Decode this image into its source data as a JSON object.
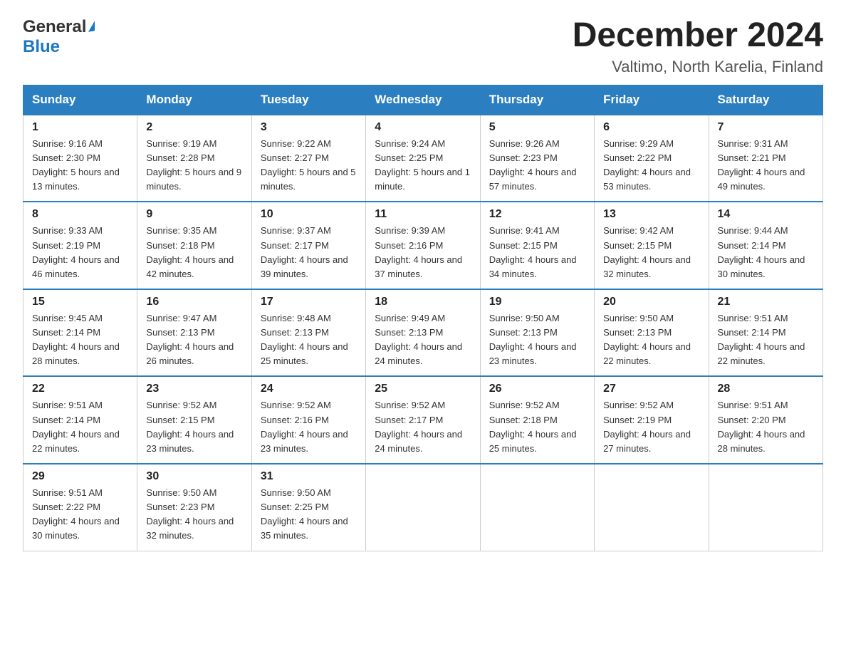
{
  "logo": {
    "general": "General",
    "triangle": "▶",
    "blue": "Blue"
  },
  "title": "December 2024",
  "subtitle": "Valtimo, North Karelia, Finland",
  "days": [
    "Sunday",
    "Monday",
    "Tuesday",
    "Wednesday",
    "Thursday",
    "Friday",
    "Saturday"
  ],
  "weeks": [
    [
      {
        "num": "1",
        "sunrise": "9:16 AM",
        "sunset": "2:30 PM",
        "daylight": "5 hours and 13 minutes."
      },
      {
        "num": "2",
        "sunrise": "9:19 AM",
        "sunset": "2:28 PM",
        "daylight": "5 hours and 9 minutes."
      },
      {
        "num": "3",
        "sunrise": "9:22 AM",
        "sunset": "2:27 PM",
        "daylight": "5 hours and 5 minutes."
      },
      {
        "num": "4",
        "sunrise": "9:24 AM",
        "sunset": "2:25 PM",
        "daylight": "5 hours and 1 minute."
      },
      {
        "num": "5",
        "sunrise": "9:26 AM",
        "sunset": "2:23 PM",
        "daylight": "4 hours and 57 minutes."
      },
      {
        "num": "6",
        "sunrise": "9:29 AM",
        "sunset": "2:22 PM",
        "daylight": "4 hours and 53 minutes."
      },
      {
        "num": "7",
        "sunrise": "9:31 AM",
        "sunset": "2:21 PM",
        "daylight": "4 hours and 49 minutes."
      }
    ],
    [
      {
        "num": "8",
        "sunrise": "9:33 AM",
        "sunset": "2:19 PM",
        "daylight": "4 hours and 46 minutes."
      },
      {
        "num": "9",
        "sunrise": "9:35 AM",
        "sunset": "2:18 PM",
        "daylight": "4 hours and 42 minutes."
      },
      {
        "num": "10",
        "sunrise": "9:37 AM",
        "sunset": "2:17 PM",
        "daylight": "4 hours and 39 minutes."
      },
      {
        "num": "11",
        "sunrise": "9:39 AM",
        "sunset": "2:16 PM",
        "daylight": "4 hours and 37 minutes."
      },
      {
        "num": "12",
        "sunrise": "9:41 AM",
        "sunset": "2:15 PM",
        "daylight": "4 hours and 34 minutes."
      },
      {
        "num": "13",
        "sunrise": "9:42 AM",
        "sunset": "2:15 PM",
        "daylight": "4 hours and 32 minutes."
      },
      {
        "num": "14",
        "sunrise": "9:44 AM",
        "sunset": "2:14 PM",
        "daylight": "4 hours and 30 minutes."
      }
    ],
    [
      {
        "num": "15",
        "sunrise": "9:45 AM",
        "sunset": "2:14 PM",
        "daylight": "4 hours and 28 minutes."
      },
      {
        "num": "16",
        "sunrise": "9:47 AM",
        "sunset": "2:13 PM",
        "daylight": "4 hours and 26 minutes."
      },
      {
        "num": "17",
        "sunrise": "9:48 AM",
        "sunset": "2:13 PM",
        "daylight": "4 hours and 25 minutes."
      },
      {
        "num": "18",
        "sunrise": "9:49 AM",
        "sunset": "2:13 PM",
        "daylight": "4 hours and 24 minutes."
      },
      {
        "num": "19",
        "sunrise": "9:50 AM",
        "sunset": "2:13 PM",
        "daylight": "4 hours and 23 minutes."
      },
      {
        "num": "20",
        "sunrise": "9:50 AM",
        "sunset": "2:13 PM",
        "daylight": "4 hours and 22 minutes."
      },
      {
        "num": "21",
        "sunrise": "9:51 AM",
        "sunset": "2:14 PM",
        "daylight": "4 hours and 22 minutes."
      }
    ],
    [
      {
        "num": "22",
        "sunrise": "9:51 AM",
        "sunset": "2:14 PM",
        "daylight": "4 hours and 22 minutes."
      },
      {
        "num": "23",
        "sunrise": "9:52 AM",
        "sunset": "2:15 PM",
        "daylight": "4 hours and 23 minutes."
      },
      {
        "num": "24",
        "sunrise": "9:52 AM",
        "sunset": "2:16 PM",
        "daylight": "4 hours and 23 minutes."
      },
      {
        "num": "25",
        "sunrise": "9:52 AM",
        "sunset": "2:17 PM",
        "daylight": "4 hours and 24 minutes."
      },
      {
        "num": "26",
        "sunrise": "9:52 AM",
        "sunset": "2:18 PM",
        "daylight": "4 hours and 25 minutes."
      },
      {
        "num": "27",
        "sunrise": "9:52 AM",
        "sunset": "2:19 PM",
        "daylight": "4 hours and 27 minutes."
      },
      {
        "num": "28",
        "sunrise": "9:51 AM",
        "sunset": "2:20 PM",
        "daylight": "4 hours and 28 minutes."
      }
    ],
    [
      {
        "num": "29",
        "sunrise": "9:51 AM",
        "sunset": "2:22 PM",
        "daylight": "4 hours and 30 minutes."
      },
      {
        "num": "30",
        "sunrise": "9:50 AM",
        "sunset": "2:23 PM",
        "daylight": "4 hours and 32 minutes."
      },
      {
        "num": "31",
        "sunrise": "9:50 AM",
        "sunset": "2:25 PM",
        "daylight": "4 hours and 35 minutes."
      },
      null,
      null,
      null,
      null
    ]
  ]
}
